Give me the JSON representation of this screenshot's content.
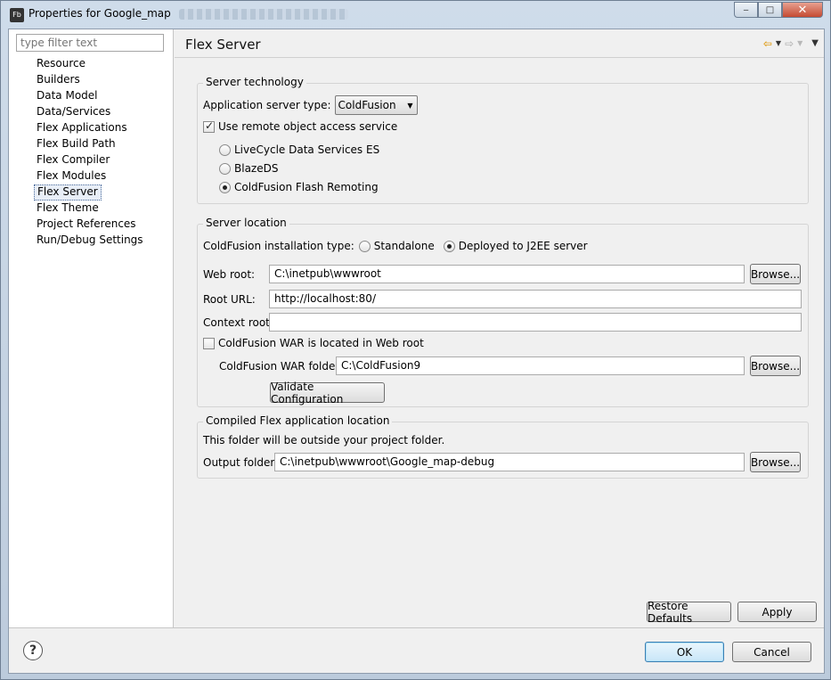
{
  "window": {
    "title": "Properties for Google_map",
    "app_icon": "Fb",
    "controls": {
      "minimize": "‒",
      "maximize": "□",
      "close": "✕"
    }
  },
  "sidebar": {
    "filter_placeholder": "type filter text",
    "items": [
      {
        "label": "Resource"
      },
      {
        "label": "Builders"
      },
      {
        "label": "Data Model"
      },
      {
        "label": "Data/Services"
      },
      {
        "label": "Flex Applications"
      },
      {
        "label": "Flex Build Path"
      },
      {
        "label": "Flex Compiler"
      },
      {
        "label": "Flex Modules"
      },
      {
        "label": "Flex Server",
        "selected": true
      },
      {
        "label": "Flex Theme"
      },
      {
        "label": "Project References"
      },
      {
        "label": "Run/Debug Settings"
      }
    ]
  },
  "page": {
    "title": "Flex Server",
    "nav": {
      "back": "⇦",
      "forward": "⇨",
      "dropdown": "▼"
    }
  },
  "server_technology": {
    "title": "Server technology",
    "app_server_label": "Application server type:",
    "app_server_value": "ColdFusion",
    "remote_object_label": "Use remote object access service",
    "remote_object_checked": true,
    "options": [
      {
        "label": "LiveCycle Data Services ES",
        "selected": false
      },
      {
        "label": "BlazeDS",
        "selected": false
      },
      {
        "label": "ColdFusion Flash Remoting",
        "selected": true
      }
    ]
  },
  "server_location": {
    "title": "Server location",
    "install_type_label": "ColdFusion installation type:",
    "install_options": [
      {
        "label": "Standalone",
        "selected": false
      },
      {
        "label": "Deployed to J2EE server",
        "selected": true
      }
    ],
    "web_root_label": "Web root:",
    "web_root_value": "C:\\inetpub\\wwwroot",
    "root_url_label": "Root URL:",
    "root_url_value": "http://localhost:80/",
    "context_root_label": "Context root:",
    "context_root_value": "",
    "war_in_webroot_label": "ColdFusion WAR is located in Web root",
    "war_in_webroot_checked": false,
    "war_folder_label": "ColdFusion WAR folder:",
    "war_folder_value": "C:\\ColdFusion9",
    "browse_label": "Browse...",
    "validate_label": "Validate Configuration"
  },
  "output": {
    "title": "Compiled Flex application location",
    "note": "This folder will be outside your project folder.",
    "folder_label": "Output folder:",
    "folder_value": "C:\\inetpub\\wwwroot\\Google_map-debug",
    "browse_label": "Browse..."
  },
  "actions": {
    "restore_defaults": "Restore Defaults",
    "apply": "Apply",
    "ok": "OK",
    "cancel": "Cancel",
    "help": "?"
  }
}
